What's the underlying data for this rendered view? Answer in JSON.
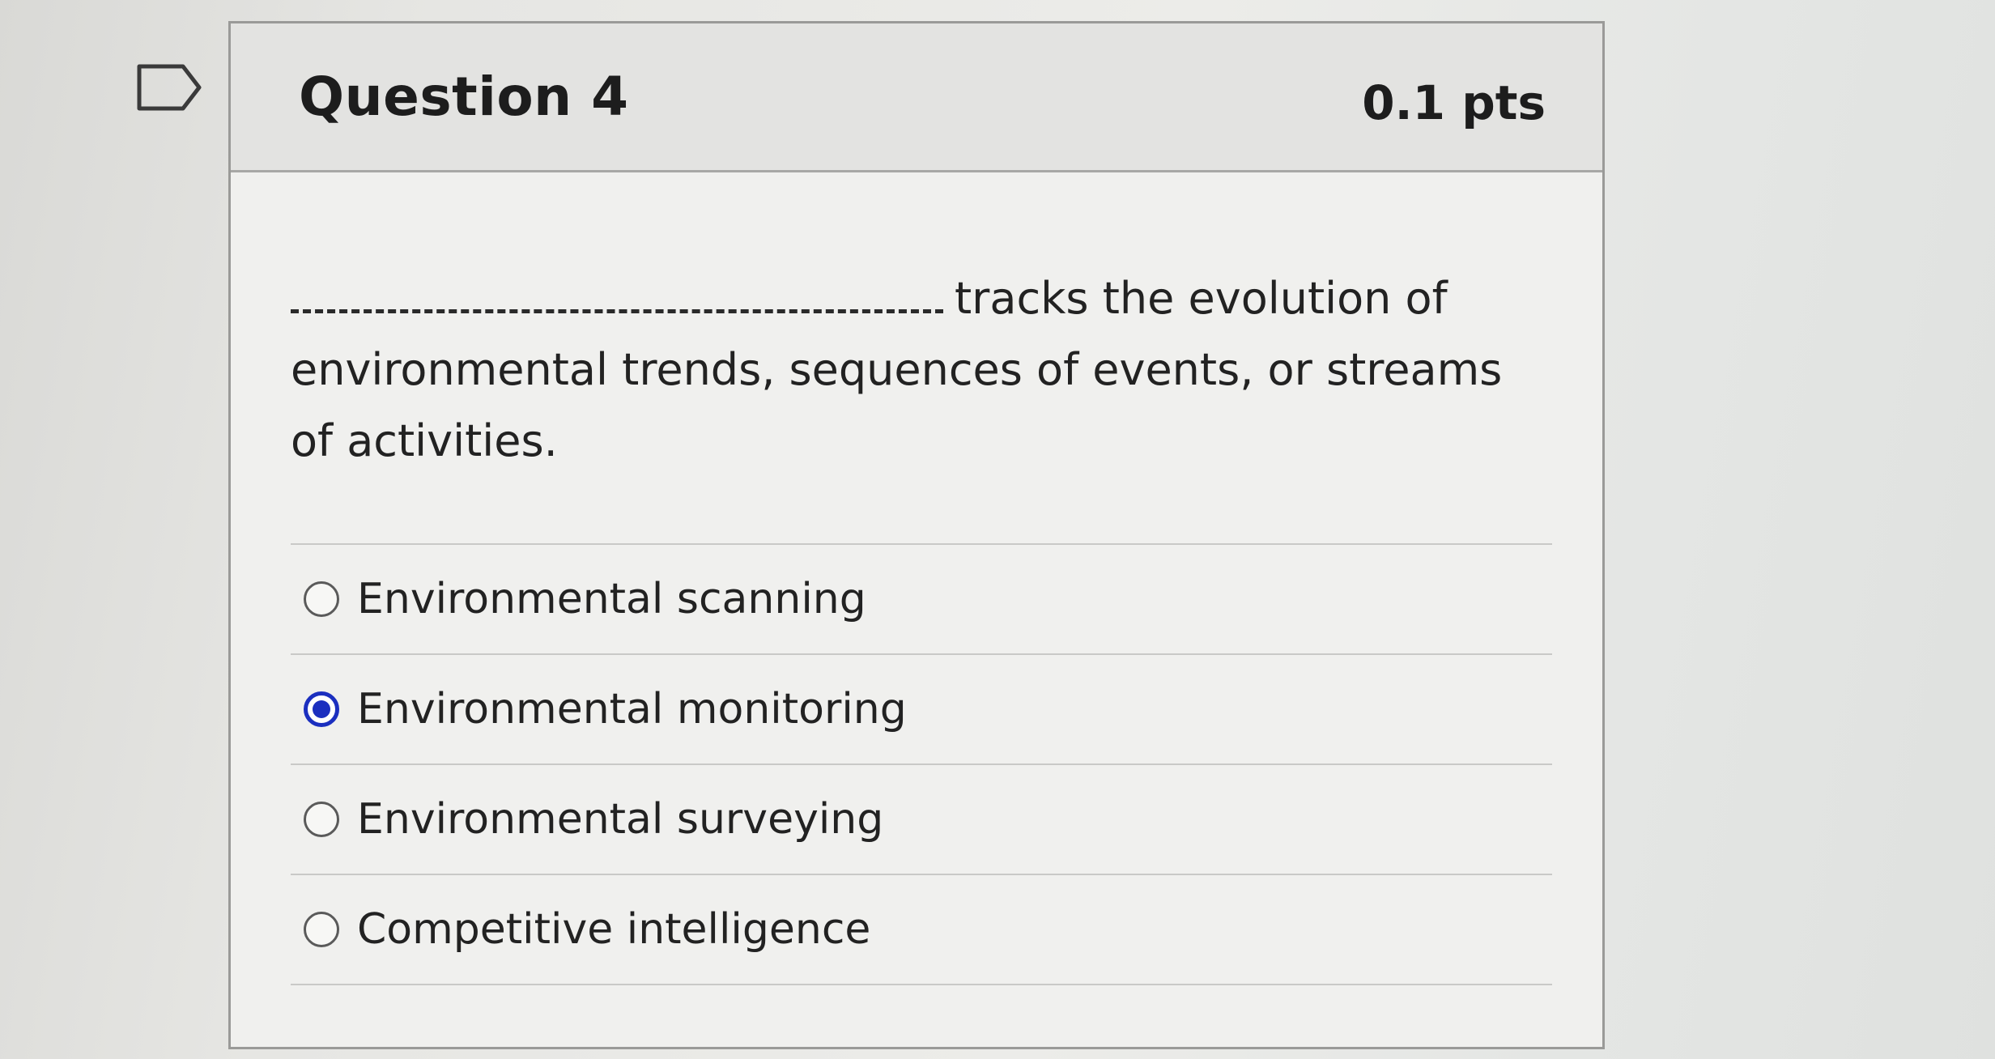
{
  "question": {
    "title": "Question 4",
    "points": "0.1 pts",
    "prompt_text": "tracks the evolution of environmental trends, sequences of events, or streams of activities.",
    "flag_icon": "bookmark-flag-icon"
  },
  "answers": [
    {
      "label": "Environmental scanning",
      "selected": false
    },
    {
      "label": "Environmental monitoring",
      "selected": true
    },
    {
      "label": "Environmental surveying",
      "selected": false
    },
    {
      "label": "Competitive intelligence",
      "selected": false
    }
  ],
  "colors": {
    "selected_radio": "#1b2fbf",
    "header_background": "#e3e3e1",
    "card_border": "#9a9a98"
  }
}
